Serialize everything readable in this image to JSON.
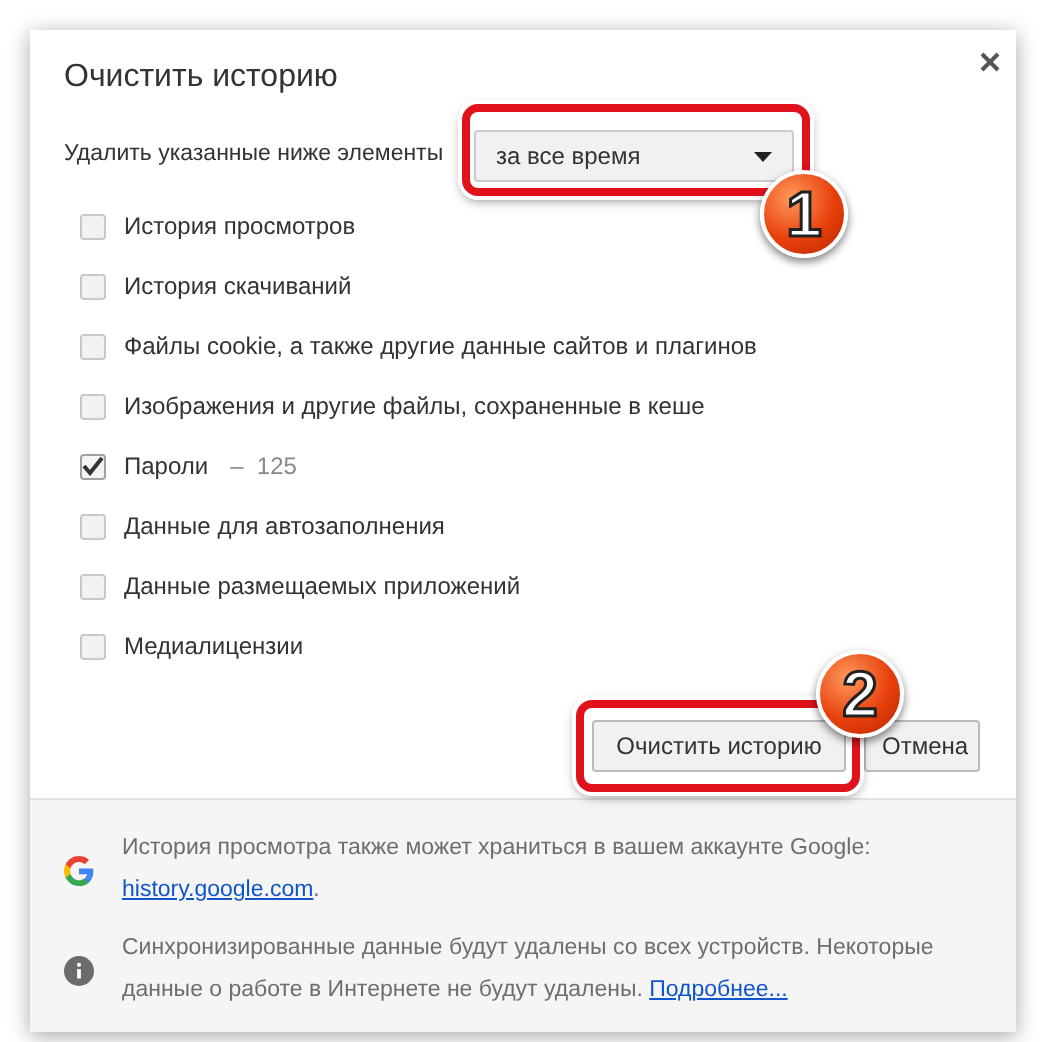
{
  "dialog": {
    "title": "Очистить историю",
    "range_label": "Удалить указанные ниже элементы",
    "range_value": "за все время",
    "items": [
      {
        "label": "История просмотров",
        "checked": false
      },
      {
        "label": "История скачиваний",
        "checked": false
      },
      {
        "label": "Файлы cookie, а также другие данные сайтов и плагинов",
        "checked": false
      },
      {
        "label": "Изображения и другие файлы, сохраненные в кеше",
        "checked": false
      },
      {
        "label": "Пароли",
        "count": "–  125",
        "checked": true
      },
      {
        "label": "Данные для автозаполнения",
        "checked": false
      },
      {
        "label": "Данные размещаемых приложений",
        "checked": false
      },
      {
        "label": "Медиалицензии",
        "checked": false
      }
    ],
    "buttons": [
      {
        "label": "Очистить историю",
        "kind": "primary"
      },
      {
        "label": "Отмена",
        "kind": "cancel"
      }
    ],
    "footer": [
      {
        "kind": "google",
        "text": "История просмотра также может храниться в вашем аккаунте Google: ",
        "link": "history.google.com",
        "after": "."
      },
      {
        "kind": "info",
        "text": "Синхронизированные данные будут удалены со всех устройств. Некоторые данные о работе в Интернете не будут удалены. ",
        "link": "Подробнее..."
      }
    ]
  },
  "annotations": [
    {
      "number": "1"
    },
    {
      "number": "2"
    }
  ]
}
